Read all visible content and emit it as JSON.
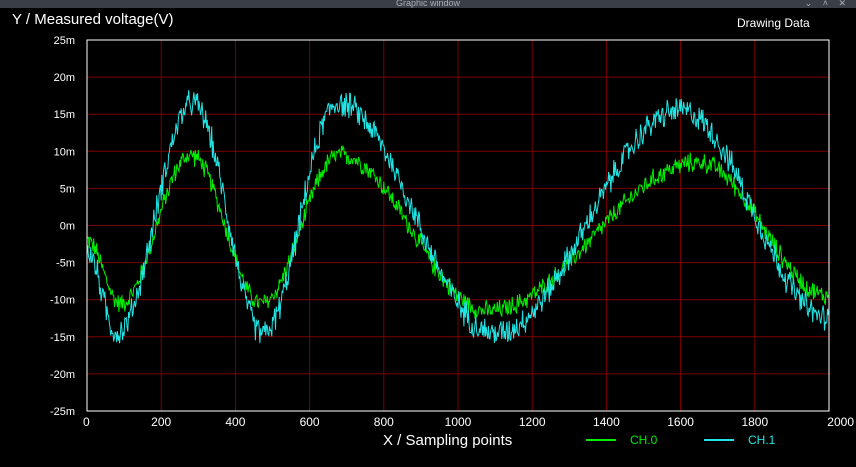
{
  "window": {
    "title": "Graphic window",
    "controls": "⌄ ˄ ✕"
  },
  "status_text": "Drawing Data",
  "colors": {
    "background": "#000000",
    "grid": "#7a0000",
    "frame": "#ffffff",
    "ch0": "#00ee00",
    "ch1": "#22e4e4"
  },
  "chart_data": {
    "type": "line",
    "xlabel": "X / Sampling points",
    "ylabel": "Y / Measured voltage(V)",
    "xlim": [
      0,
      2000
    ],
    "ylim": [
      -0.025,
      0.025
    ],
    "x_ticks": [
      0,
      200,
      400,
      600,
      800,
      1000,
      1200,
      1400,
      1600,
      1800,
      2000
    ],
    "x_tick_labels": [
      "0",
      "200",
      "400",
      "600",
      "800",
      "1000",
      "1200",
      "1400",
      "1600",
      "1800",
      "2000"
    ],
    "y_ticks": [
      -0.025,
      -0.02,
      -0.015,
      -0.01,
      -0.005,
      0,
      0.005,
      0.01,
      0.015,
      0.02,
      0.025
    ],
    "y_tick_labels": [
      "-25m",
      "-20m",
      "-15m",
      "-10m",
      "-5m",
      "0m",
      "5m",
      "10m",
      "15m",
      "20m",
      "25m"
    ],
    "grid": true,
    "legend_position": "bottom-right",
    "series": [
      {
        "name": "CH.0",
        "color": "#00ee00",
        "noise_amplitude": 0.0016,
        "x": [
          0,
          90,
          280,
          470,
          680,
          1080,
          1650,
          2000
        ],
        "y": [
          -0.002,
          -0.0105,
          0.0095,
          -0.0105,
          0.0095,
          -0.0115,
          0.0085,
          -0.0095
        ]
      },
      {
        "name": "CH.1",
        "color": "#22e4e4",
        "noise_amplitude": 0.0022,
        "x": [
          0,
          80,
          285,
          475,
          675,
          1100,
          1600,
          2000
        ],
        "y": [
          -0.0035,
          -0.0145,
          0.0165,
          -0.0145,
          0.0165,
          -0.0145,
          0.0155,
          -0.0125
        ]
      }
    ]
  }
}
